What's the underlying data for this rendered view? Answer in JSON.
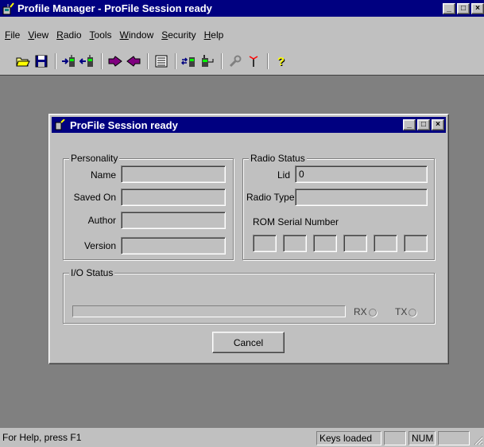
{
  "app": {
    "title": "Profile Manager - ProFile Session ready",
    "caption_buttons": [
      "_",
      "□",
      "×"
    ]
  },
  "menu": {
    "items": [
      {
        "key": "F",
        "rest": "ile"
      },
      {
        "key": "V",
        "rest": "iew"
      },
      {
        "key": "R",
        "rest": "adio"
      },
      {
        "key": "T",
        "rest": "ools"
      },
      {
        "key": "W",
        "rest": "indow"
      },
      {
        "key": "S",
        "rest": "ecurity"
      },
      {
        "key": "H",
        "rest": "elp"
      }
    ]
  },
  "toolbar": {
    "buttons": [
      {
        "icon": "open-folder-icon",
        "glyph": "📂"
      },
      {
        "icon": "save-disk-icon",
        "glyph": "💾"
      },
      {
        "icon": "read-radio-icon",
        "glyph": "→"
      },
      {
        "icon": "write-radio-icon",
        "glyph": "←"
      },
      {
        "icon": "upload-arrow-icon",
        "glyph": "➔"
      },
      {
        "icon": "download-arrow-icon",
        "glyph": "◀"
      },
      {
        "icon": "list-view-icon",
        "glyph": "▤"
      },
      {
        "icon": "clone-radio-icon",
        "glyph": "⇄"
      },
      {
        "icon": "radio-connect-icon",
        "glyph": "📟"
      },
      {
        "icon": "wrench-icon",
        "glyph": "🔧"
      },
      {
        "icon": "antenna-icon",
        "glyph": "Ÿ"
      },
      {
        "icon": "help-question-icon",
        "glyph": "?"
      }
    ]
  },
  "child": {
    "title": "ProFile Session ready",
    "personality": {
      "legend": "Personality",
      "name_label": "Name",
      "saved_on_label": "Saved On",
      "author_label": "Author",
      "version_label": "Version",
      "name_value": "",
      "saved_on_value": "",
      "author_value": "",
      "version_value": ""
    },
    "radio_status": {
      "legend": "Radio Status",
      "lid_label": "Lid",
      "lid_value": "0",
      "radio_type_label": "Radio Type",
      "radio_type_value": "",
      "rom_serial_label": "ROM Serial Number",
      "rom_cells": [
        "",
        "",
        "",
        "",
        "",
        ""
      ]
    },
    "io_status": {
      "legend": "I/O Status",
      "rx_label": "RX",
      "tx_label": "TX",
      "progress": 0
    },
    "cancel_label": "Cancel"
  },
  "status": {
    "help": "For Help, press F1",
    "keys": "Keys loaded",
    "blank1": "",
    "num": "NUM",
    "blank2": ""
  },
  "colors": {
    "titlebar": "#000080",
    "face": "#c0c0c0",
    "mdi_background": "#808080"
  }
}
